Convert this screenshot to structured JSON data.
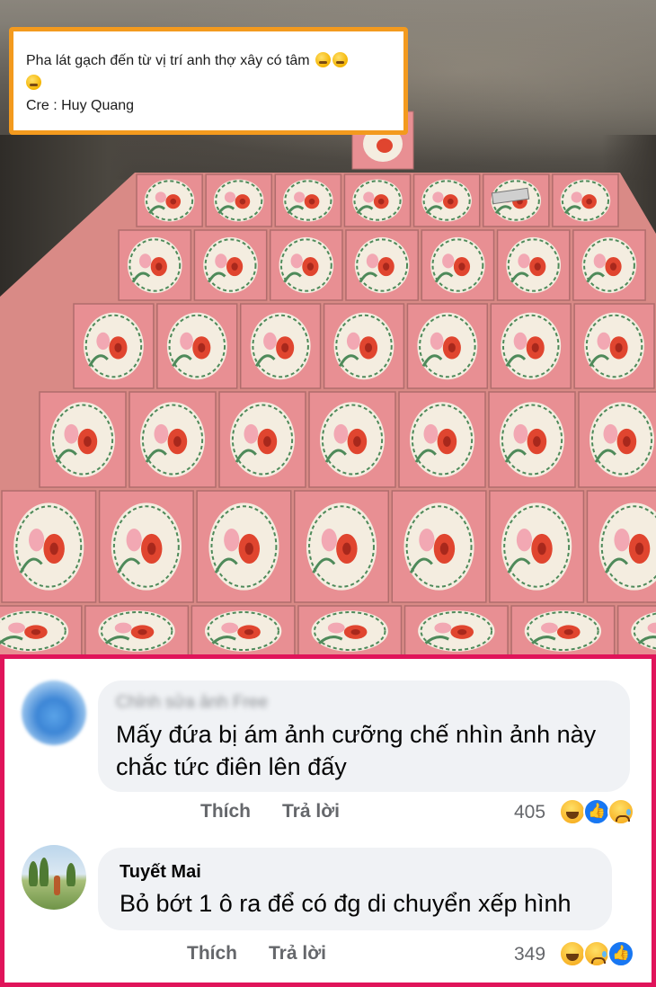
{
  "post": {
    "caption_line1": "Pha lát gạch đến từ vị trí anh thợ xây có tâm",
    "caption_emojis": [
      "laugh-cry-icon",
      "laugh-cry-icon",
      "laugh-cry-icon"
    ],
    "caption_line2": "Cre : Huy Quang",
    "caption_border_color": "#f39a1e"
  },
  "comments_section": {
    "border_color": "#e0145a",
    "comments": [
      {
        "author": "Chỉnh sửa ảnh Free",
        "author_blurred": true,
        "text": "Mấy đứa bị ám ảnh cưỡng chế nhìn ảnh này chắc tức điên lên đấy",
        "like_label": "Thích",
        "reply_label": "Trả lời",
        "reaction_count": "405",
        "reactions": [
          "haha-reaction-icon",
          "like-reaction-icon",
          "sad-reaction-icon"
        ]
      },
      {
        "author": "Tuyết Mai",
        "author_blurred": false,
        "text": "Bỏ bớt 1 ô ra để có đg di chuyển xếp hình",
        "like_label": "Thích",
        "reply_label": "Trả lời",
        "reaction_count": "349",
        "reactions": [
          "haha-reaction-icon",
          "sad-reaction-icon",
          "like-reaction-icon"
        ]
      }
    ]
  },
  "colors": {
    "tile_pink": "#e88f93",
    "tile_cream": "#f4ede0",
    "flower_red": "#e0452f",
    "leaf_green": "#4e8a5a",
    "comment_bubble": "#f0f2f5",
    "like_blue": "#1877f2"
  }
}
